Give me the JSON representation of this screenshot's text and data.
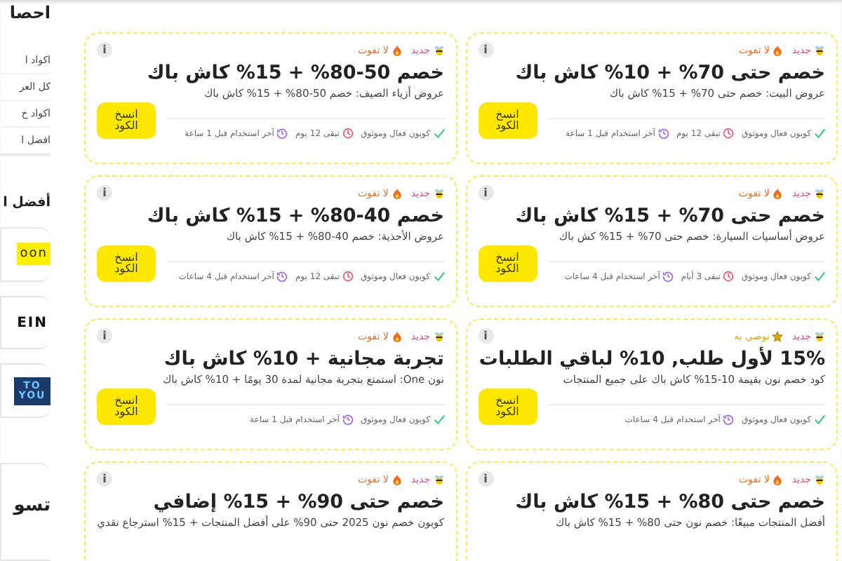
{
  "sidebar": {
    "heading": "احصا",
    "links": [
      "اكواد ا",
      "كل العر",
      "اكواد خ",
      "افضل ا"
    ],
    "brands_heading": "أفضل ا",
    "brands": [
      {
        "label": "oon",
        "kind": "yellow"
      },
      {
        "label": "EIN",
        "kind": "plain"
      },
      {
        "label": "TO YOU",
        "kind": "navy"
      }
    ],
    "bottom_heading": "تسو"
  },
  "coupons": [
    {
      "info": "i",
      "badges": [
        {
          "label": "جديد",
          "kind": "new"
        },
        {
          "label": "لا تفوت",
          "kind": "hot"
        }
      ],
      "title": "خصم حتى 70% + 10% كاش باك",
      "description": "عروض البيت: خصم حتى 70% + 15% كاش باك",
      "button": "انسخ الكود",
      "meta": [
        {
          "kind": "verified",
          "text": "كوبون فعال وموثوق"
        },
        {
          "kind": "remaining",
          "text": "تبقى 12 يوم"
        },
        {
          "kind": "last-used",
          "text": "آخر استخدام قبل 1 ساعة"
        }
      ]
    },
    {
      "info": "i",
      "badges": [
        {
          "label": "جديد",
          "kind": "new"
        },
        {
          "label": "لا تفوت",
          "kind": "hot"
        }
      ],
      "title": "خصم 50-80% + 15% كاش باك",
      "description": "عروض أزياء الصيف: خصم 50-80% + 15% كاش باك",
      "button": "انسخ الكود",
      "meta": [
        {
          "kind": "verified",
          "text": "كوبون فعال وموثوق"
        },
        {
          "kind": "remaining",
          "text": "تبقى 12 يوم"
        },
        {
          "kind": "last-used",
          "text": "آخر استخدام قبل 1 ساعة"
        }
      ]
    },
    {
      "info": "i",
      "badges": [
        {
          "label": "جديد",
          "kind": "new"
        },
        {
          "label": "لا تفوت",
          "kind": "hot"
        }
      ],
      "title": "خصم حتى 70% + 15% كاش باك",
      "description": "عروض أساسيات السيارة: خصم حتى 70% + 15% كش باك",
      "button": "انسخ الكود",
      "meta": [
        {
          "kind": "verified",
          "text": "كوبون فعال وموثوق"
        },
        {
          "kind": "remaining",
          "text": "تبقى 3 أيام"
        },
        {
          "kind": "last-used",
          "text": "آخر استخدام قبل 4 ساعات"
        }
      ]
    },
    {
      "info": "i",
      "badges": [
        {
          "label": "جديد",
          "kind": "new"
        },
        {
          "label": "لا تفوت",
          "kind": "hot"
        }
      ],
      "title": "خصم 40-80% + 15% كاش باك",
      "description": "عروض الأحذية: خصم 40-80% + 15% كاش باك",
      "button": "انسخ الكود",
      "meta": [
        {
          "kind": "verified",
          "text": "كوبون فعال وموثوق"
        },
        {
          "kind": "remaining",
          "text": "تبقى 12 يوم"
        },
        {
          "kind": "last-used",
          "text": "آخر استخدام قبل 4 ساعات"
        }
      ]
    },
    {
      "info": "i",
      "badges": [
        {
          "label": "جديد",
          "kind": "new"
        },
        {
          "label": "نوصي به",
          "kind": "recommended"
        }
      ],
      "title": "15% لأول طلب, 10% لباقي الطلبات",
      "description": "كود خصم نون بقيمة 10-15% كاش باك على جميع المنتجات",
      "button": "انسخ الكود",
      "meta": [
        {
          "kind": "verified",
          "text": "كوبون فعال وموثوق"
        },
        {
          "kind": "last-used",
          "text": "آخر استخدام قبل 4 ساعات"
        }
      ]
    },
    {
      "info": "i",
      "badges": [
        {
          "label": "جديد",
          "kind": "new"
        },
        {
          "label": "لا تفوت",
          "kind": "hot"
        }
      ],
      "title": "تجربة مجانية + 10% كاش باك",
      "description": "نون One: استمتع بتجربة مجانية لمدة 30 يومًا + 10% كاش باك",
      "button": "انسخ الكود",
      "meta": [
        {
          "kind": "verified",
          "text": "كوبون فعال وموثوق"
        },
        {
          "kind": "last-used",
          "text": "آخر استخدام قبل 1 ساعة"
        }
      ]
    },
    {
      "info": "i",
      "badges": [
        {
          "label": "جديد",
          "kind": "new"
        },
        {
          "label": "لا تفوت",
          "kind": "hot"
        }
      ],
      "title": "خصم حتى 80% + 15% كاش باك",
      "description": "أفضل المنتجات مبيعًا: خصم نون حتى 80% + 15% كاش باك"
    },
    {
      "info": "i",
      "badges": [
        {
          "label": "جديد",
          "kind": "new"
        },
        {
          "label": "لا تفوت",
          "kind": "hot"
        }
      ],
      "title": "خصم حتى 90% + 15% إضافي",
      "description": "كوبون خصم نون 2025 حتى 90% على أفضل المنتجات + 15% استرجاع نقدي"
    }
  ]
}
